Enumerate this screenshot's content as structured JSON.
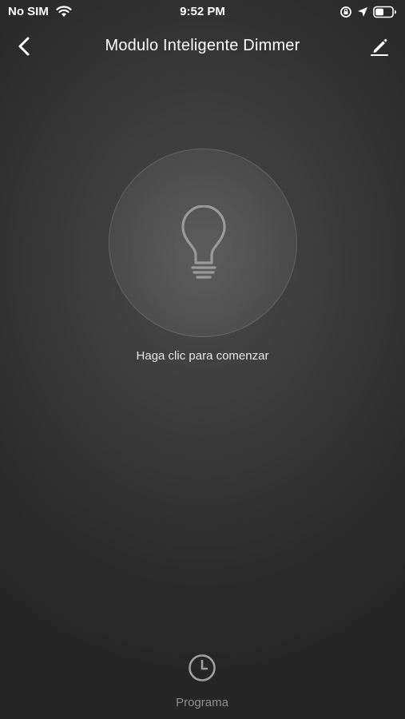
{
  "status_bar": {
    "carrier": "No SIM",
    "time": "9:52 PM",
    "icons": [
      "wifi-icon",
      "orientation-lock-icon",
      "location-icon",
      "battery-icon"
    ],
    "battery_level": 0.5
  },
  "header": {
    "title": "Modulo Inteligente Dimmer",
    "back_icon": "chevron-left-icon",
    "edit_icon": "pencil-icon"
  },
  "main": {
    "power_icon": "lightbulb-icon",
    "hint": "Haga clic para comenzar"
  },
  "footer": {
    "schedule_icon": "clock-icon",
    "schedule_label": "Programa"
  },
  "colors": {
    "background_center": "#4c4c4c",
    "background_edge": "#262626",
    "text": "#ffffff",
    "muted_text": "#8e8e8e",
    "icon_gray": "#9a9a9a"
  }
}
